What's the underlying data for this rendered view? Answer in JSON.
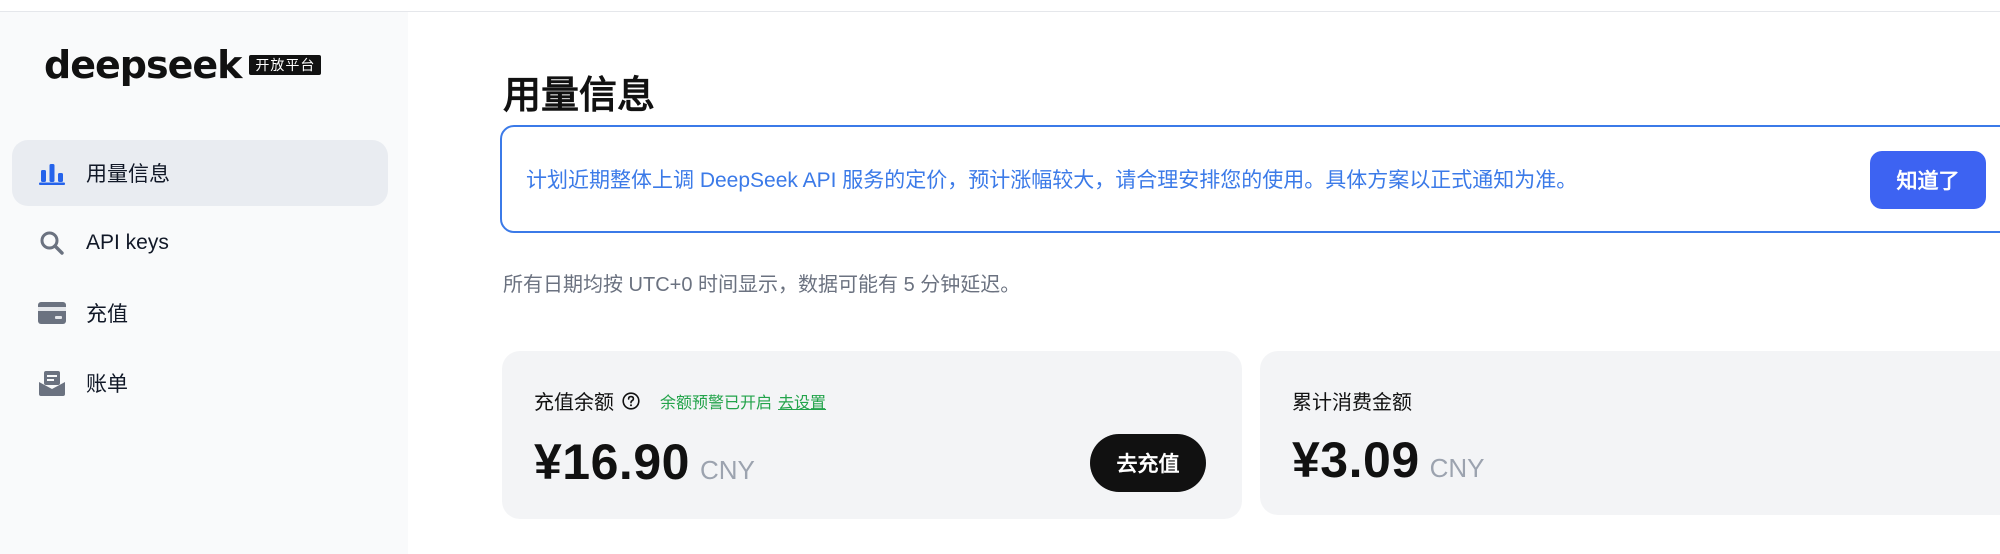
{
  "brand": {
    "name": "deepseek",
    "tag": "开放平台"
  },
  "sidebar": {
    "items": [
      {
        "label": "用量信息",
        "icon": "bar-chart-icon",
        "active": true
      },
      {
        "label": "API keys",
        "icon": "search-key-icon",
        "active": false
      },
      {
        "label": "充值",
        "icon": "card-icon",
        "active": false
      },
      {
        "label": "账单",
        "icon": "bill-icon",
        "active": false
      }
    ]
  },
  "main": {
    "title": "用量信息",
    "notice": {
      "text": "计划近期整体上调 DeepSeek API 服务的定价，预计涨幅较大，请合理安排您的使用。具体方案以正式通知为准。",
      "button": "知道了"
    },
    "timezone_note": "所有日期均按 UTC+0 时间显示，数据可能有 5 分钟延迟。",
    "balance_card": {
      "label": "充值余额",
      "alert_text": "余额预警已开启",
      "alert_link": "去设置",
      "amount": "¥16.90",
      "currency": "CNY",
      "button": "去充值"
    },
    "spend_card": {
      "label": "累计消费金额",
      "amount": "¥3.09",
      "currency": "CNY"
    }
  },
  "colors": {
    "accent": "#3d63f2",
    "notice": "#3b7ae8",
    "alert": "#22a34a",
    "sidebar_bg": "#f9fafb"
  }
}
